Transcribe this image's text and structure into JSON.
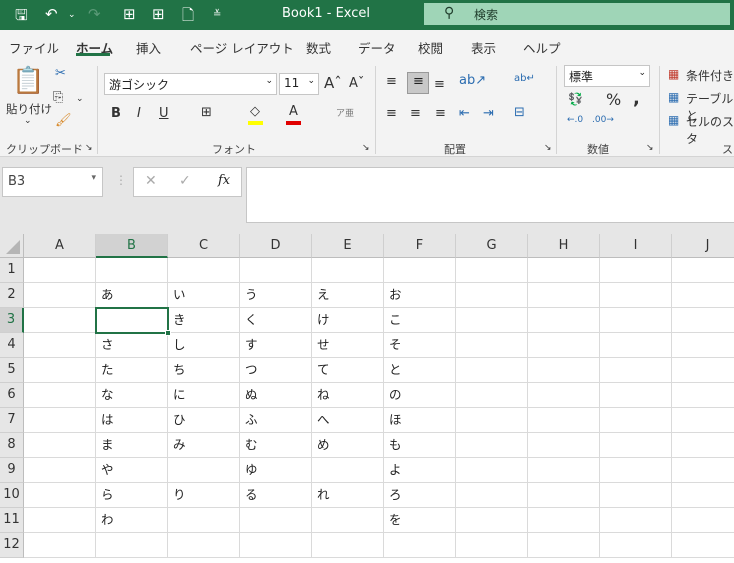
{
  "titlebar": {
    "title": "Book1  -  Excel",
    "search_placeholder": "検索",
    "icons": [
      "save-icon",
      "undo-icon",
      "redo-icon",
      "form-icon",
      "table-icon",
      "new-file-icon",
      "customize-qat-icon"
    ]
  },
  "tabs": [
    {
      "label": "ファイル"
    },
    {
      "label": "ホーム",
      "active": true
    },
    {
      "label": "挿入"
    },
    {
      "label": "ページ レイアウト"
    },
    {
      "label": "数式"
    },
    {
      "label": "データ"
    },
    {
      "label": "校閲"
    },
    {
      "label": "表示"
    },
    {
      "label": "ヘルプ"
    }
  ],
  "ribbon": {
    "clipboard": {
      "label": "クリップボード",
      "paste": "貼り付け"
    },
    "font": {
      "label": "フォント",
      "font_name": "游ゴシック",
      "font_size": "11",
      "bold": "B",
      "italic": "I",
      "underline": "U",
      "font_color": "#e00000",
      "fill_color": "#ffff00"
    },
    "alignment": {
      "label": "配置"
    },
    "number": {
      "label": "数値",
      "format": "標準"
    },
    "styles": {
      "label": "ス",
      "conditional": "条件付き",
      "table": "テーブルと",
      "cell": "セルのスタ"
    }
  },
  "formula_bar": {
    "name_box": "B3",
    "formula": ""
  },
  "accent": "#217346",
  "sheet": {
    "columns": [
      "A",
      "B",
      "C",
      "D",
      "E",
      "F",
      "G",
      "H",
      "I",
      "J"
    ],
    "rows": [
      "1",
      "2",
      "3",
      "4",
      "5",
      "6",
      "7",
      "8",
      "9",
      "10",
      "11",
      "12"
    ],
    "selected_cell": "B3",
    "cells": [
      [
        "",
        "",
        "",
        "",
        "",
        "",
        "",
        "",
        "",
        ""
      ],
      [
        "",
        "あ",
        "い",
        "う",
        "え",
        "お",
        "",
        "",
        "",
        ""
      ],
      [
        "",
        "",
        "き",
        "く",
        "け",
        "こ",
        "",
        "",
        "",
        ""
      ],
      [
        "",
        "さ",
        "し",
        "す",
        "せ",
        "そ",
        "",
        "",
        "",
        ""
      ],
      [
        "",
        "た",
        "ち",
        "つ",
        "て",
        "と",
        "",
        "",
        "",
        ""
      ],
      [
        "",
        "な",
        "に",
        "ぬ",
        "ね",
        "の",
        "",
        "",
        "",
        ""
      ],
      [
        "",
        "は",
        "ひ",
        "ふ",
        "へ",
        "ほ",
        "",
        "",
        "",
        ""
      ],
      [
        "",
        "ま",
        "み",
        "む",
        "め",
        "も",
        "",
        "",
        "",
        ""
      ],
      [
        "",
        "や",
        "",
        "ゆ",
        "",
        "よ",
        "",
        "",
        "",
        ""
      ],
      [
        "",
        "ら",
        "り",
        "る",
        "れ",
        "ろ",
        "",
        "",
        "",
        ""
      ],
      [
        "",
        "わ",
        "",
        "",
        "",
        "を",
        "",
        "",
        "",
        ""
      ],
      [
        "",
        "",
        "",
        "",
        "",
        "",
        "",
        "",
        "",
        ""
      ]
    ]
  }
}
